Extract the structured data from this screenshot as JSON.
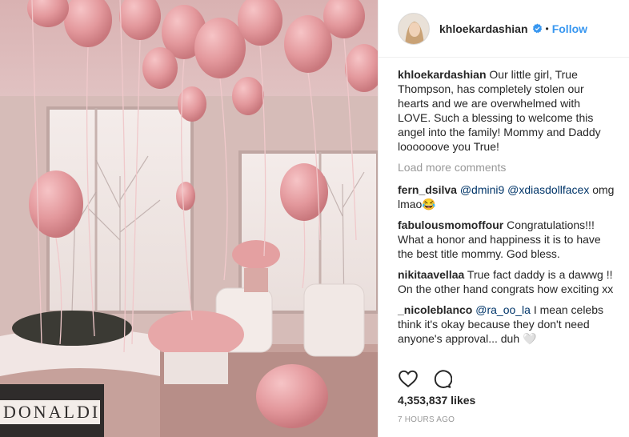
{
  "header": {
    "username": "khloekardashian",
    "follow_label": "Follow",
    "dot": "•"
  },
  "caption": {
    "username": "khloekardashian",
    "text": "Our little girl, True Thompson, has completely stolen our hearts and we are overwhelmed with LOVE. Such a blessing to welcome this angel into the family! Mommy and Daddy loooooove you True!"
  },
  "load_more_label": "Load more comments",
  "comments": [
    {
      "username": "fern_dsilva",
      "mentions": "@dmini9 @xdiasdollfacex",
      "text": " omg lmao😂"
    },
    {
      "username": "fabulousmomoffour",
      "mentions": "",
      "text": "Congratulations!!! What a honor and happiness it is to have the best title mommy. God bless."
    },
    {
      "username": "nikitaavellaa",
      "mentions": "",
      "text": "True fact daddy is a dawwg !! On the other hand congrats how exciting xx"
    },
    {
      "username": "_nicoleblanco",
      "mentions": "@ra_oo_la",
      "text": " I mean celebs think it's okay because they don't need anyone's approval... duh 🤍"
    }
  ],
  "likes": "4,353,837 likes",
  "time": "7 HOURS AGO",
  "photo": {
    "box_text": "DONALDI"
  },
  "icons": {
    "verified": "verified-badge-icon",
    "like": "heart-icon",
    "comment": "comment-bubble-icon"
  },
  "colors": {
    "follow": "#3897f0",
    "verified": "#3897f0",
    "mention": "#003569",
    "balloon": "#e8989c"
  }
}
